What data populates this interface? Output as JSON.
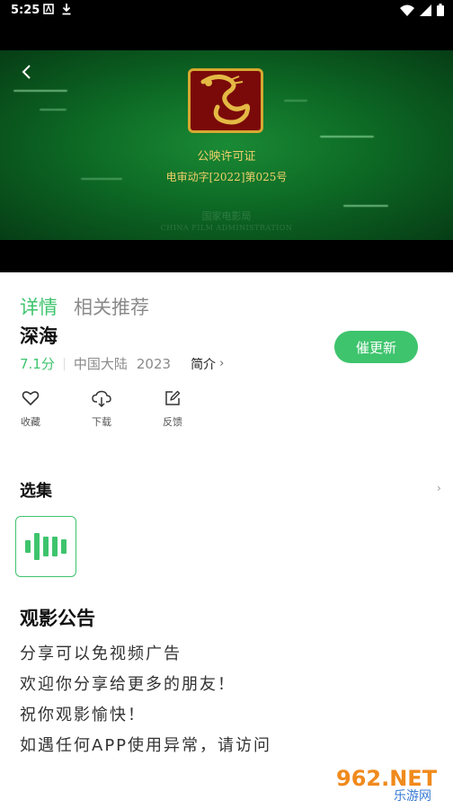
{
  "status_bar": {
    "time": "5:25"
  },
  "video": {
    "license_title": "公映许可证",
    "license_number": "电审动字[2022]第025号",
    "faint_org": "国家电影局",
    "faint_org_en": "CHINA FILM ADMINISTRATION"
  },
  "tabs": [
    {
      "label": "详情",
      "active": true
    },
    {
      "label": "相关推荐",
      "active": false
    }
  ],
  "movie": {
    "title": "深海",
    "rating": "7.1分",
    "region": "中国大陆",
    "year": "2023",
    "intro_label": "简介"
  },
  "update_button": {
    "label": "催更新"
  },
  "actions": [
    {
      "icon": "heart-icon",
      "label": "收藏"
    },
    {
      "icon": "cloud-download-icon",
      "label": "下载"
    },
    {
      "icon": "edit-feedback-icon",
      "label": "反馈"
    }
  ],
  "episodes": {
    "section_title": "选集"
  },
  "notice": {
    "title": "观影公告",
    "lines": [
      "分享可以免视频广告",
      "欢迎你分享给更多的朋友！",
      "祝你观影愉快！",
      "如遇任何APP使用异常，请访问"
    ]
  },
  "watermark": {
    "text": "962.NET",
    "subtext": "乐游网"
  },
  "colors": {
    "accent": "#3ec46d",
    "video_green": "#0d6a25",
    "gold": "#f0d06a"
  }
}
